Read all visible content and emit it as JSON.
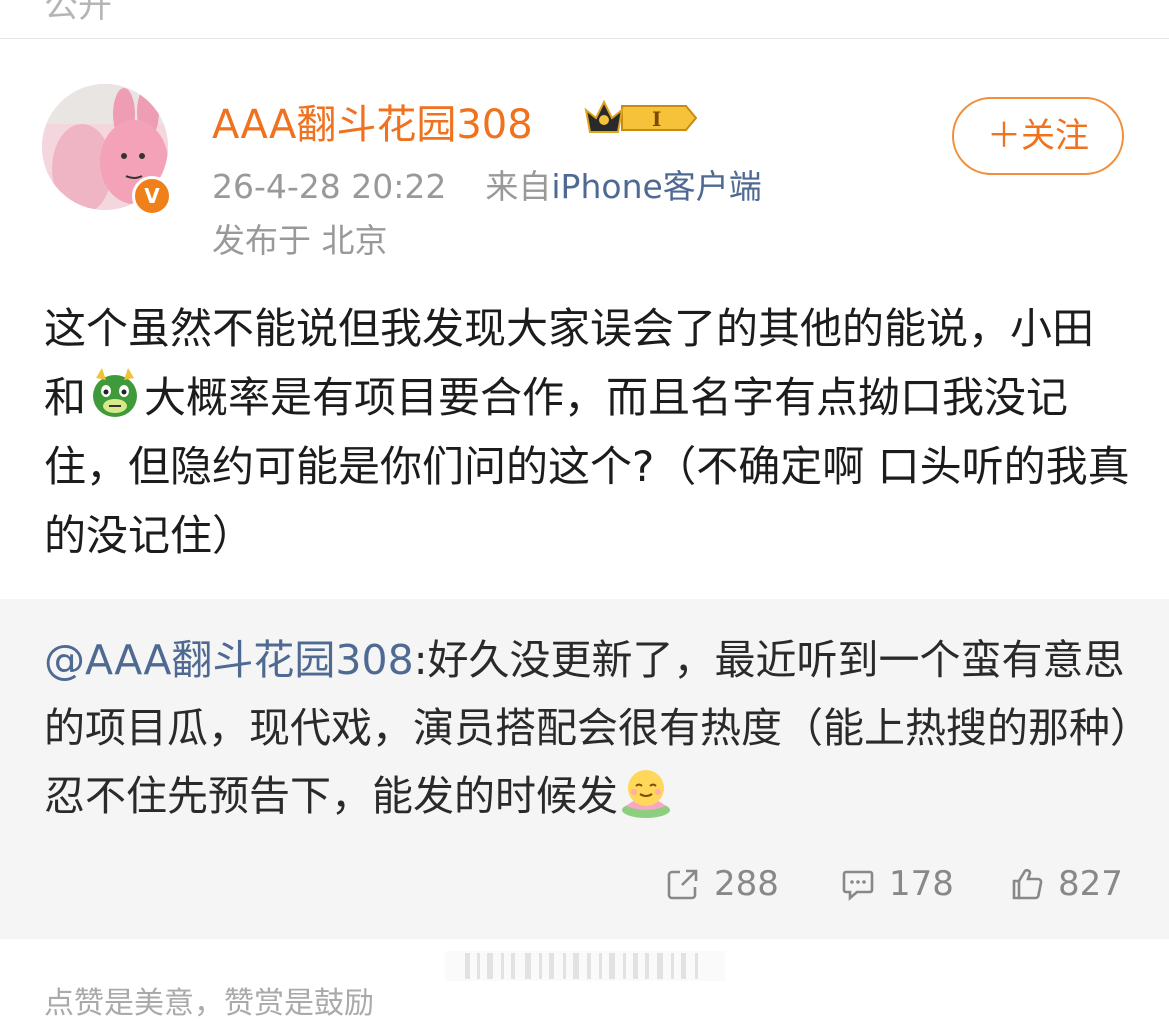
{
  "top_strip": {
    "clipped_text": "公开"
  },
  "author": {
    "username": "AAA翻斗花园308",
    "verified_mark": "V",
    "badge_text": "I",
    "timestamp": "26-4-28 20:22",
    "source_prefix": "来自",
    "source_app": "iPhone客户端",
    "location": "发布于 北京"
  },
  "follow_button": {
    "label": "＋关注"
  },
  "post": {
    "text_a": "这个虽然不能说但我发现大家误会了的其他的能说，小田和",
    "text_b": "大概率是有项目要合作，而且名字有点拗口我没记住，但隐约可能是你们问的这个?（不确定啊 口头听的我真的没记住）"
  },
  "repost": {
    "mention": "@AAA翻斗花园308",
    "text": ":好久没更新了，最近听到一个蛮有意思的项目瓜，现代戏，演员搭配会很有热度（能上热搜的那种）忍不住先预告下，能发的时候发"
  },
  "stats": {
    "reposts": "288",
    "comments": "178",
    "likes": "827"
  },
  "footer": {
    "text": "点赞是美意，赞赏是鼓励"
  },
  "colors": {
    "username": "#f0711e",
    "link": "#4f6a92",
    "meta": "#999999",
    "repost_bg": "#f5f5f5"
  },
  "icons": [
    "crown-icon",
    "dragon-emoji-icon",
    "lotus-smile-emoji-icon",
    "repost-icon",
    "comment-icon",
    "like-icon"
  ]
}
